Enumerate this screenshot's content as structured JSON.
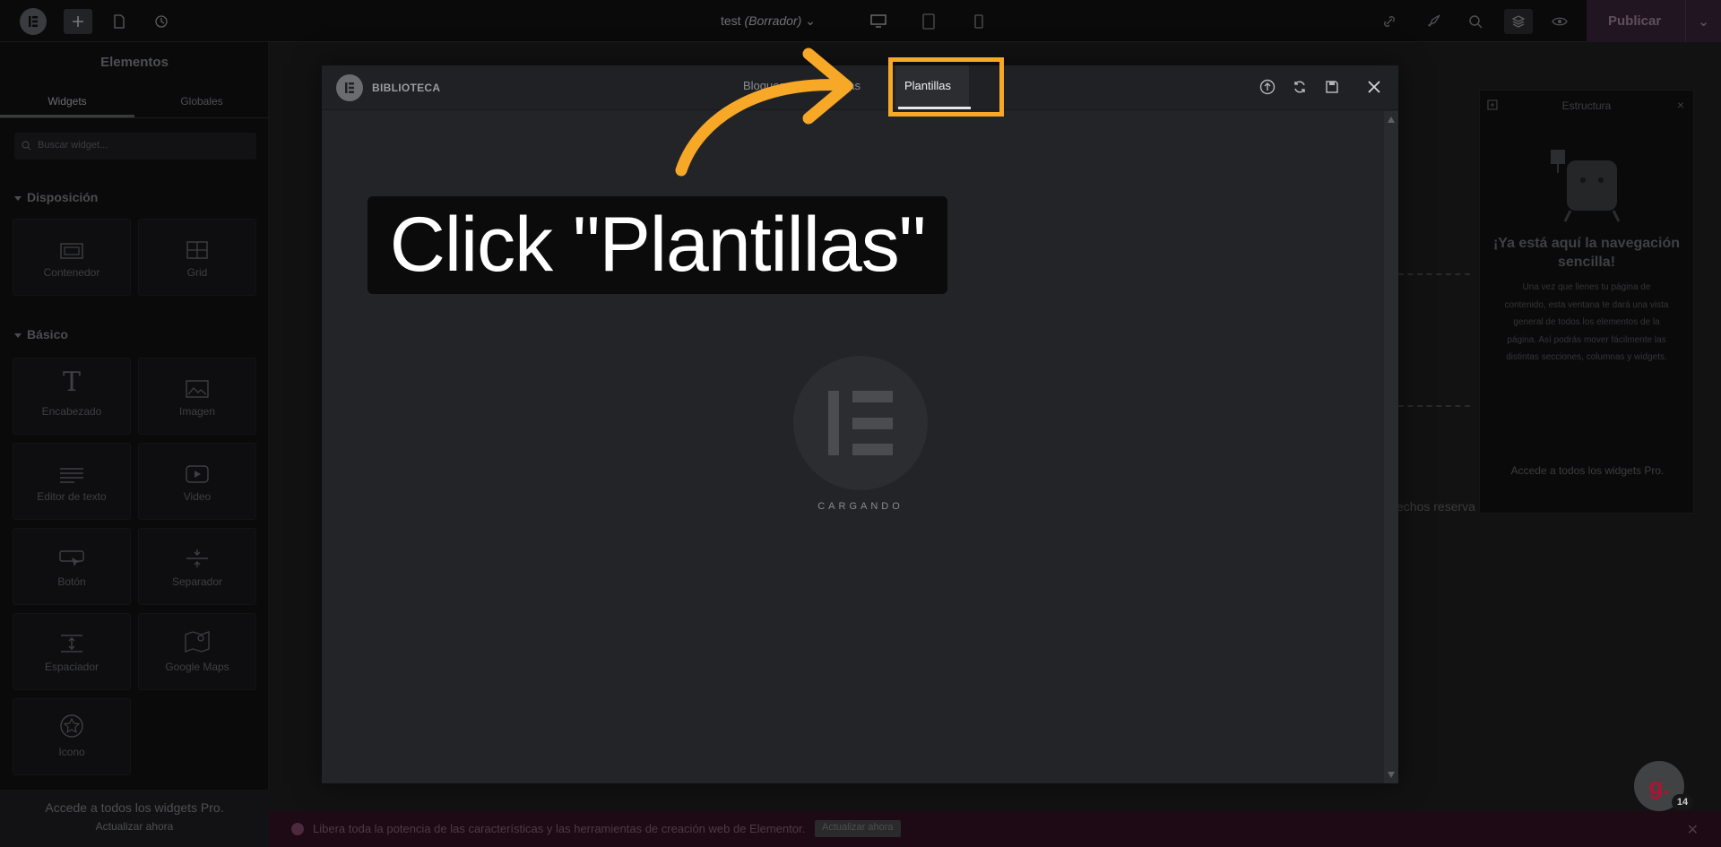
{
  "topbar": {
    "doc_name": "test",
    "doc_status": "(Borrador)",
    "publish_label": "Publicar"
  },
  "sidebar": {
    "title": "Elementos",
    "tabs": [
      "Widgets",
      "Globales"
    ],
    "search_placeholder": "Buscar widget...",
    "sections": [
      {
        "label": "Disposición",
        "items": [
          "Contenedor",
          "Grid"
        ]
      },
      {
        "label": "Básico",
        "items": [
          "Encabezado",
          "Imagen",
          "Editor de texto",
          "Video",
          "Botón",
          "Separador",
          "Espaciador",
          "Google Maps",
          "Icono"
        ]
      }
    ],
    "footer_text": "Accede a todos los widgets Pro.",
    "footer_link": "Actualizar ahora"
  },
  "structure_panel": {
    "title": "Estructura",
    "heading": "¡Ya está aquí la navegación sencilla!",
    "body": "Una vez que llenes tu página de contenido, esta ventana te dará una vista general de todos los elementos de la página. Así podrás mover fácilmente las distintas secciones, columnas y widgets.",
    "footer": "Accede a todos los widgets Pro."
  },
  "canvas": {
    "footer_text": "echos reserva"
  },
  "library_modal": {
    "title": "BIBLIOTECA",
    "tabs": [
      "Bloques",
      "Páginas",
      "Plantillas"
    ],
    "active_tab": "Plantillas",
    "loading_text": "CARGANDO"
  },
  "tutorial": {
    "callout": "Click \"Plantillas\"",
    "accent_color": "#f7a826"
  },
  "promo_bar": {
    "text": "Libera toda la potencia de las características y las herramientas de creación web de Elementor.",
    "button": "Actualizar ahora"
  },
  "avatar": {
    "letter": "g.",
    "badge": "14"
  }
}
